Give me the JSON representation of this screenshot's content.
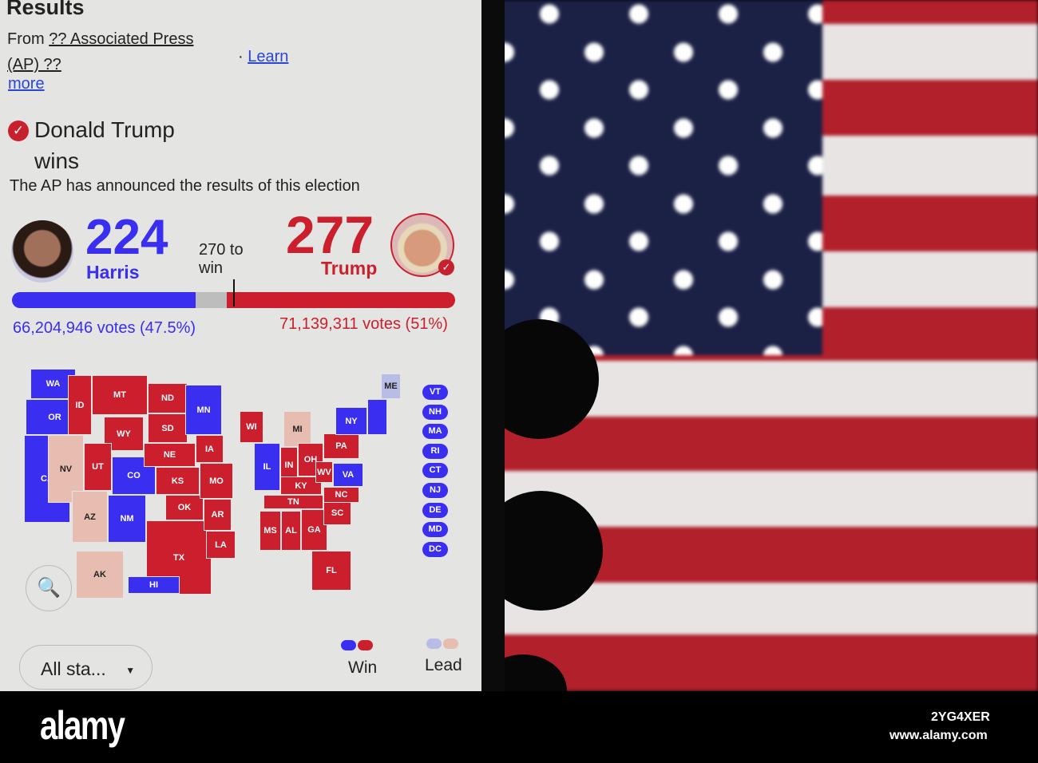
{
  "header": {
    "title": "Results",
    "source_prefix": "From",
    "source_link": "?? Associated Press (AP) ??",
    "learn_more_1": "Learn",
    "learn_more_2": "more",
    "separator": "·"
  },
  "winner": {
    "name_line1": "Donald Trump",
    "name_line2": "wins",
    "subtitle": "The AP has announced the results of this election"
  },
  "candidates": {
    "harris": {
      "name": "Harris",
      "electoral_votes": "224",
      "popular": "66,204,946 votes (47.5%)",
      "color": "#3a2ef0"
    },
    "trump": {
      "name": "Trump",
      "electoral_votes": "277",
      "popular": "71,139,311 votes (51%)",
      "color": "#cc1f2d"
    },
    "threshold_line1": "270 to",
    "threshold_line2": "win"
  },
  "bar": {
    "harris_fraction": 0.414,
    "undecided_fraction": 0.07,
    "trump_fraction": 0.516
  },
  "map": {
    "states": [
      {
        "abbr": "WA",
        "status": "win-d"
      },
      {
        "abbr": "OR",
        "status": "win-d"
      },
      {
        "abbr": "CA",
        "status": "win-d"
      },
      {
        "abbr": "NV",
        "status": "lead-r"
      },
      {
        "abbr": "ID",
        "status": "win-r"
      },
      {
        "abbr": "MT",
        "status": "win-r"
      },
      {
        "abbr": "WY",
        "status": "win-r"
      },
      {
        "abbr": "UT",
        "status": "win-r"
      },
      {
        "abbr": "CO",
        "status": "win-d"
      },
      {
        "abbr": "AZ",
        "status": "lead-r"
      },
      {
        "abbr": "NM",
        "status": "win-d"
      },
      {
        "abbr": "ND",
        "status": "win-r"
      },
      {
        "abbr": "SD",
        "status": "win-r"
      },
      {
        "abbr": "NE",
        "status": "win-r"
      },
      {
        "abbr": "KS",
        "status": "win-r"
      },
      {
        "abbr": "OK",
        "status": "win-r"
      },
      {
        "abbr": "TX",
        "status": "win-r"
      },
      {
        "abbr": "MN",
        "status": "win-d"
      },
      {
        "abbr": "IA",
        "status": "win-r"
      },
      {
        "abbr": "MO",
        "status": "win-r"
      },
      {
        "abbr": "AR",
        "status": "win-r"
      },
      {
        "abbr": "LA",
        "status": "win-r"
      },
      {
        "abbr": "WI",
        "status": "win-r"
      },
      {
        "abbr": "IL",
        "status": "win-d"
      },
      {
        "abbr": "MI",
        "status": "lead-r"
      },
      {
        "abbr": "IN",
        "status": "win-r"
      },
      {
        "abbr": "OH",
        "status": "win-r"
      },
      {
        "abbr": "KY",
        "status": "win-r"
      },
      {
        "abbr": "TN",
        "status": "win-r"
      },
      {
        "abbr": "MS",
        "status": "win-r"
      },
      {
        "abbr": "AL",
        "status": "win-r"
      },
      {
        "abbr": "GA",
        "status": "win-r"
      },
      {
        "abbr": "FL",
        "status": "win-r"
      },
      {
        "abbr": "SC",
        "status": "win-r"
      },
      {
        "abbr": "NC",
        "status": "win-r"
      },
      {
        "abbr": "WV",
        "status": "win-r"
      },
      {
        "abbr": "VA",
        "status": "win-d"
      },
      {
        "abbr": "PA",
        "status": "win-r"
      },
      {
        "abbr": "NY",
        "status": "win-d"
      },
      {
        "abbr": "ME",
        "status": "lead-d"
      },
      {
        "abbr": "AK",
        "status": "lead-r"
      },
      {
        "abbr": "HI",
        "status": "win-d"
      }
    ],
    "small_states": [
      "VT",
      "NH",
      "MA",
      "RI",
      "CT",
      "NJ",
      "DE",
      "MD",
      "DC"
    ]
  },
  "controls": {
    "filter_value": "All sta...",
    "zoom_icon": "zoom-in-icon"
  },
  "legend": {
    "win": "Win",
    "lead": "Lead",
    "colors": {
      "win_d": "#3a2ef0",
      "win_r": "#cc1f2d",
      "lead_d": "#b8bde8",
      "lead_r": "#e6bdb0"
    }
  },
  "watermark": {
    "logo": "alamy",
    "id": "2YG4XER",
    "url": "www.alamy.com"
  }
}
